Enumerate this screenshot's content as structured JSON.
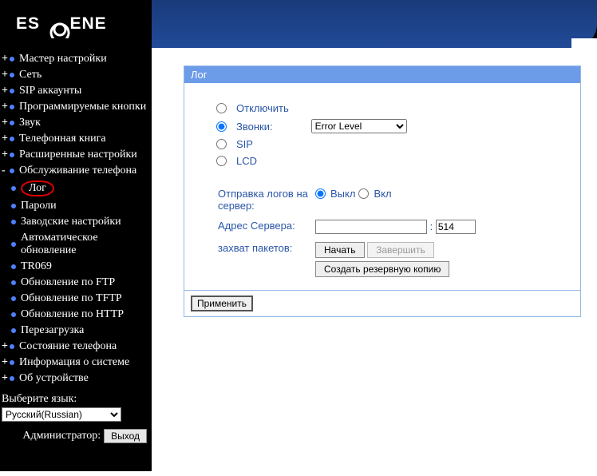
{
  "logo_text": "ESCENE",
  "sidebar": {
    "items": [
      {
        "label": "Мастер настройки"
      },
      {
        "label": "Сеть"
      },
      {
        "label": "SIP аккаунты"
      },
      {
        "label": "Программируемые кнопки"
      },
      {
        "label": "Звук"
      },
      {
        "label": "Телефонная книга"
      },
      {
        "label": "Расширенные настройки"
      }
    ],
    "expanded": {
      "label": "Обслуживание телефона",
      "children": [
        {
          "label": "Лог"
        },
        {
          "label": "Пароли"
        },
        {
          "label": "Заводские настройки"
        },
        {
          "label": "Автоматическое обновление"
        },
        {
          "label": "TR069"
        },
        {
          "label": "Обновление по FTP"
        },
        {
          "label": "Обновление по TFTP"
        },
        {
          "label": "Обновление по HTTP"
        },
        {
          "label": "Перезагрузка"
        }
      ]
    },
    "tail": [
      {
        "label": "Состояние телефона"
      },
      {
        "label": "Информация о системе"
      },
      {
        "label": "Об устройстве"
      }
    ]
  },
  "lang": {
    "label": "Выберите язык:",
    "value": "Русский(Russian)"
  },
  "admin": {
    "label": "Администратор:",
    "logout": "Выход"
  },
  "panel": {
    "title": "Лог",
    "opts": {
      "disable": "Отключить",
      "calls": "Звонки:",
      "sip": "SIP",
      "lcd": "LCD"
    },
    "loglevel_value": "Error Level",
    "send_label": "Отправка логов на сервер:",
    "off": "Выкл",
    "on": "Вкл",
    "server_label": "Адрес Сервера:",
    "server_value": "",
    "port_sep": ":",
    "port_value": "514",
    "capture_label": "захват пакетов:",
    "start": "Начать",
    "finish": "Завершить",
    "backup": "Создать резервную копию",
    "apply": "Применить"
  }
}
